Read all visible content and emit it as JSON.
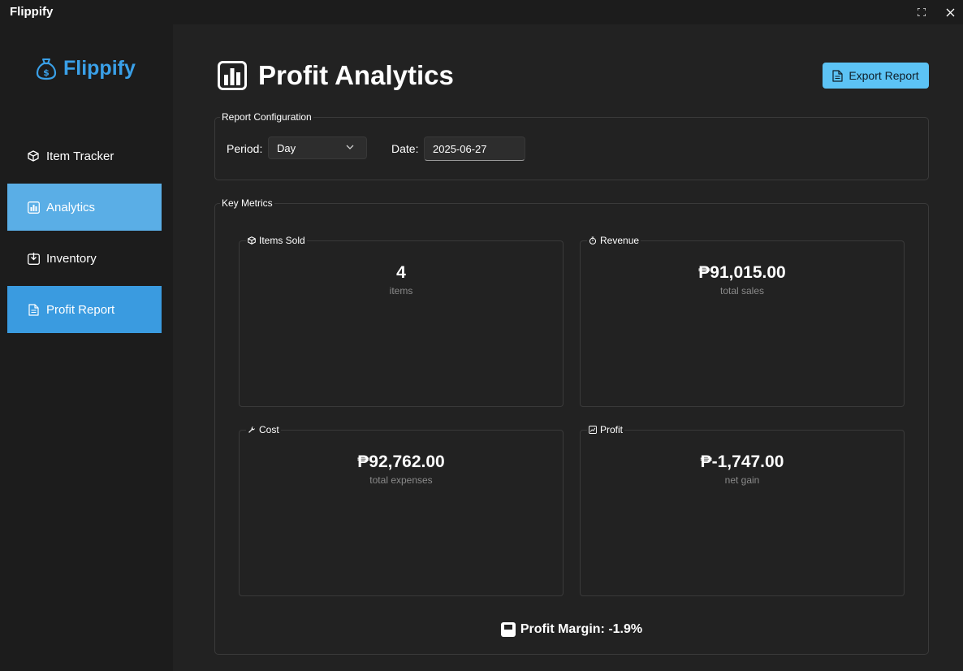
{
  "window": {
    "title": "Flippify",
    "maximize_icon": "maximize-icon",
    "close_icon": "close-icon"
  },
  "sidebar": {
    "brand": "Flippify",
    "brand_icon": "money-bag-icon",
    "brand_color": "#3aa0e8",
    "items": [
      {
        "label": "Item Tracker",
        "icon": "box-icon",
        "state": "normal"
      },
      {
        "label": "Analytics",
        "icon": "bar-chart-icon",
        "state": "selected",
        "color": "#5aaee6"
      },
      {
        "label": "Inventory",
        "icon": "inbox-icon",
        "state": "normal"
      },
      {
        "label": "Profit Report",
        "icon": "document-icon",
        "state": "highlighted",
        "color": "#3a9be0"
      }
    ]
  },
  "header": {
    "title": "Profit Analytics",
    "title_icon": "bar-chart-icon",
    "export_label": "Export Report",
    "export_icon": "document-icon",
    "export_color": "#5cc3f5"
  },
  "config": {
    "group_label": "Report Configuration",
    "period_label": "Period:",
    "period_value": "Day",
    "date_label": "Date:",
    "date_value": "2025-06-27"
  },
  "metrics": {
    "group_label": "Key Metrics",
    "cards": [
      {
        "label": "Items Sold",
        "icon": "box-icon",
        "value": "4",
        "sub": "items"
      },
      {
        "label": "Revenue",
        "icon": "stopwatch-icon",
        "value": "₱91,015.00",
        "sub": "total sales"
      },
      {
        "label": "Cost",
        "icon": "wrench-icon",
        "value": "₱92,762.00",
        "sub": "total expenses"
      },
      {
        "label": "Profit",
        "icon": "chart-icon",
        "value": "₱-1,747.00",
        "sub": "net gain"
      }
    ],
    "margin_text": "Profit Margin: -1.9%",
    "margin_icon": "chart-box-icon"
  }
}
